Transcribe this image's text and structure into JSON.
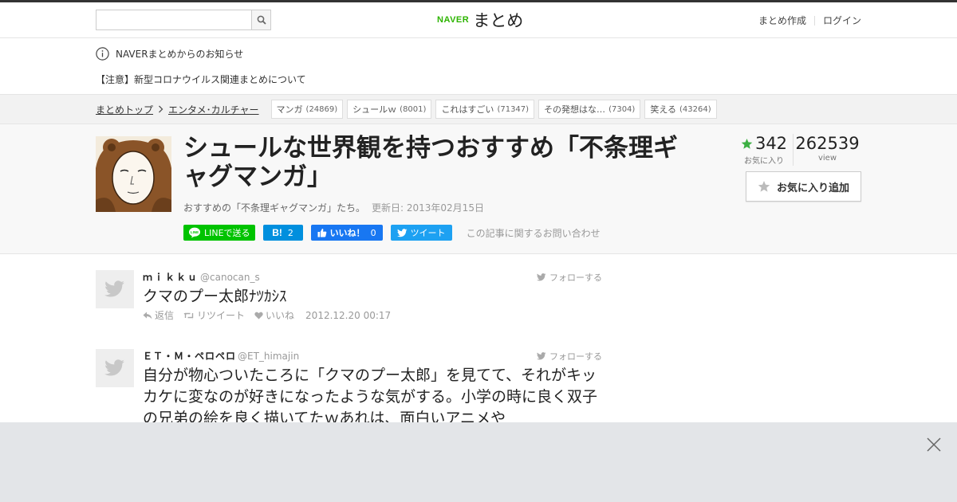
{
  "header": {
    "search_placeholder": "",
    "logo_naver": "NAVER",
    "logo_matome": "まとめ",
    "create_link": "まとめ作成",
    "login_link": "ログイン"
  },
  "notice": {
    "title": "NAVERまとめからのお知らせ",
    "link": "【注意】新型コロナウイルス関連まとめについて"
  },
  "breadcrumb": {
    "items": [
      "まとめトップ",
      "エンタメ･カルチャー"
    ],
    "tags": [
      {
        "label": "マンガ",
        "count": "(24869)"
      },
      {
        "label": "シュールｗ",
        "count": "(8001)"
      },
      {
        "label": "これはすごい",
        "count": "(71347)"
      },
      {
        "label": "その発想はな…",
        "count": "(7304)"
      },
      {
        "label": "笑える",
        "count": "(43264)"
      }
    ]
  },
  "article": {
    "title": "シュールな世界観を持つおすすめ「不条理ギャグマンガ」",
    "description": "おすすめの「不条理ギャグマンガ」たち。",
    "updated": "更新日: 2013年02月15日",
    "share": {
      "line": "LINEで送る",
      "hatena_count": "2",
      "like_label": "いいね！",
      "like_count": "0",
      "tweet": "ツイート"
    },
    "inquiry": "この記事に関するお問い合わせ",
    "favorites": "342",
    "favorites_label": "お気に入り",
    "views": "262539",
    "views_label": "view",
    "fav_button": "お気に入り追加"
  },
  "tweets": [
    {
      "name": "ｍｉｋｋｕ",
      "handle": "@canocan_s",
      "follow": "フォローする",
      "text": "クマのプー太郎ﾅﾂｶｼｽ",
      "reply": "返信",
      "retweet": "リツイート",
      "like": "いいね",
      "time": "2012.12.20 00:17"
    },
    {
      "name": "ＥＴ・Ｍ・ペロペロ",
      "handle": "@ET_himajin",
      "follow": "フォローする",
      "text": "自分が物心ついたころに「クマのプー太郎」を見てて、それがキッカケに変なのが好きになったような気がする。小学の時に良く双子の兄弟の絵を良く描いてたｗあれは、面白いアニメや"
    }
  ],
  "colors": {
    "naver_green": "#2db400",
    "line_green": "#00c300",
    "hatena_blue": "#008fde",
    "facebook_blue": "#1877f2",
    "twitter_blue": "#1da1f2",
    "star_green": "#3cb043"
  }
}
